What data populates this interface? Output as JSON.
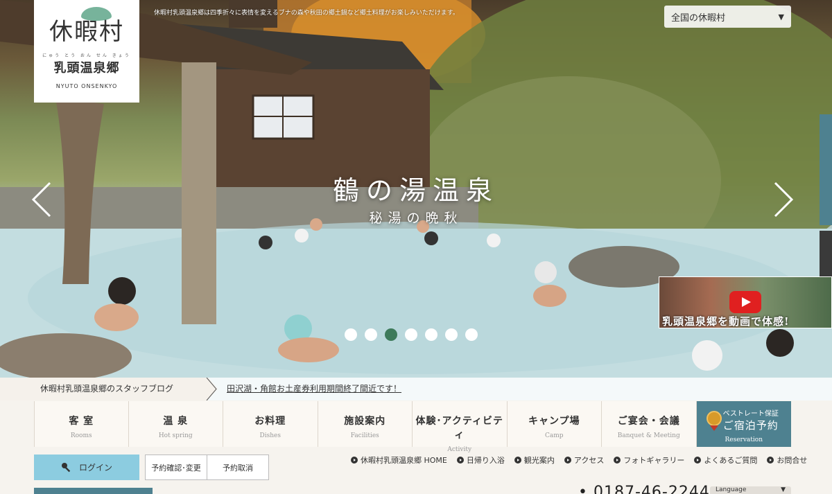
{
  "header": {
    "tagline": "休暇村乳頭温泉郷は四季折々に表情を変えるブナの森や秋田の郷土鍋など郷土料理がお楽しみいただけます。",
    "logo": {
      "kanji": "休暇村",
      "furigana": "にゅう とう おん せん きょう",
      "name": "乳頭温泉郷",
      "roman": "NYUTO ONSENKYO"
    },
    "region_select": {
      "value": "全国の休暇村",
      "icon": "caret-down-icon"
    }
  },
  "hero": {
    "title": "鶴の湯温泉",
    "subtitle": "秘湯の晩秋",
    "slide_count": 7,
    "active_slide": 3,
    "prev_icon": "chevron-left-icon",
    "next_icon": "chevron-right-icon",
    "video_banner": {
      "text": "乳頭温泉郷を動画で体感!",
      "icon": "youtube-play-icon"
    }
  },
  "news": {
    "label": "休暇村乳頭温泉郷のスタッフブログ",
    "headline": "田沢湖・角館お土産券利用期間終了間近です！"
  },
  "nav": {
    "items": [
      {
        "ja": "客 室",
        "en": "Rooms"
      },
      {
        "ja": "温 泉",
        "en": "Hot spring"
      },
      {
        "ja": "お料理",
        "en": "Dishes"
      },
      {
        "ja": "施設案内",
        "en": "Facilities"
      },
      {
        "ja": "体験･アクティビティ",
        "en": "Activity"
      },
      {
        "ja": "キャンプ場",
        "en": "Camp"
      },
      {
        "ja": "ご宴会・会議",
        "en": "Banquet & Meeting"
      }
    ],
    "reservation": {
      "best": "ベストレート保証",
      "label": "ご宿泊予約",
      "en": "Reservation",
      "icon": "medal-icon"
    }
  },
  "utility": {
    "login": {
      "label": "ログイン",
      "icon": "key-icon"
    },
    "confirm_label": "予約確認･変更",
    "cancel_label": "予約取消",
    "links": [
      "休暇村乳頭温泉郷 HOME",
      "日帰り入浴",
      "観光案内",
      "アクセス",
      "フォトギャラリー",
      "よくあるご質問",
      "お問合せ"
    ],
    "phone": "0187-46-2244",
    "language": "Language"
  },
  "colors": {
    "accent_teal": "#4e8190",
    "login_blue": "#8ccce0",
    "active_dot": "#3d7a5a",
    "youtube_red": "#e02020"
  }
}
